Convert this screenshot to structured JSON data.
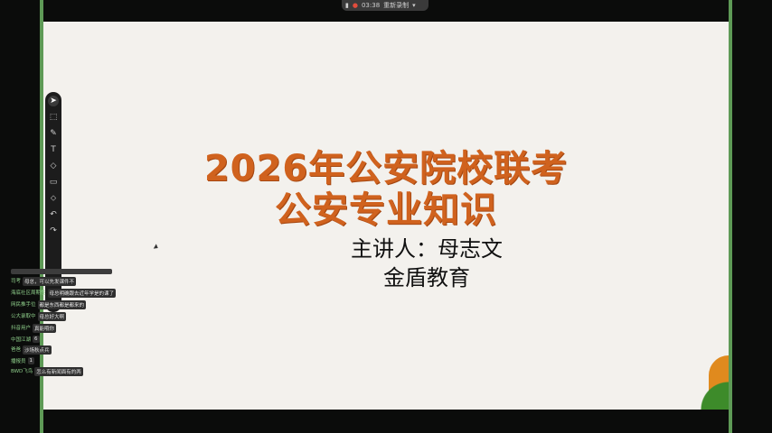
{
  "topbar": {
    "time": "03:38",
    "record_label": "重新录制",
    "menu_icon": "chevron-down-icon"
  },
  "slide": {
    "title_line1": "2026年公安院校联考",
    "title_line2": "公安专业知识",
    "lecturer": "主讲人：母志文",
    "organization": "金盾教育"
  },
  "toolbar": {
    "tools": [
      "select-icon",
      "box-select-icon",
      "pen-icon",
      "text-icon",
      "eraser-icon",
      "rectangle-icon",
      "shape-icon",
      "undo-icon",
      "redo-icon"
    ]
  },
  "chat": {
    "messages": [
      {
        "user": "司考",
        "text": "母总，可以先发课件不"
      },
      {
        "user": "海底社区周期性",
        "text": "母总明确跟去近年学是的课了"
      },
      {
        "user": "网民推手位",
        "text": "都是东西都是都来的"
      },
      {
        "user": "公大录取中",
        "text": "母总好大啊"
      },
      {
        "user": "抖音用户",
        "text": "真能哦你"
      },
      {
        "user": "中国江湖",
        "text": "6"
      },
      {
        "user": "爸爸",
        "text": "沙场秋点兵"
      },
      {
        "user": "播报员",
        "text": "1"
      },
      {
        "user": "BWD飞鸟",
        "text": "怎么有新闻面有的两"
      }
    ]
  },
  "colors": {
    "title": "#d0621e",
    "frame": "#5e9a56",
    "slide_bg": "#f3f1ed"
  }
}
